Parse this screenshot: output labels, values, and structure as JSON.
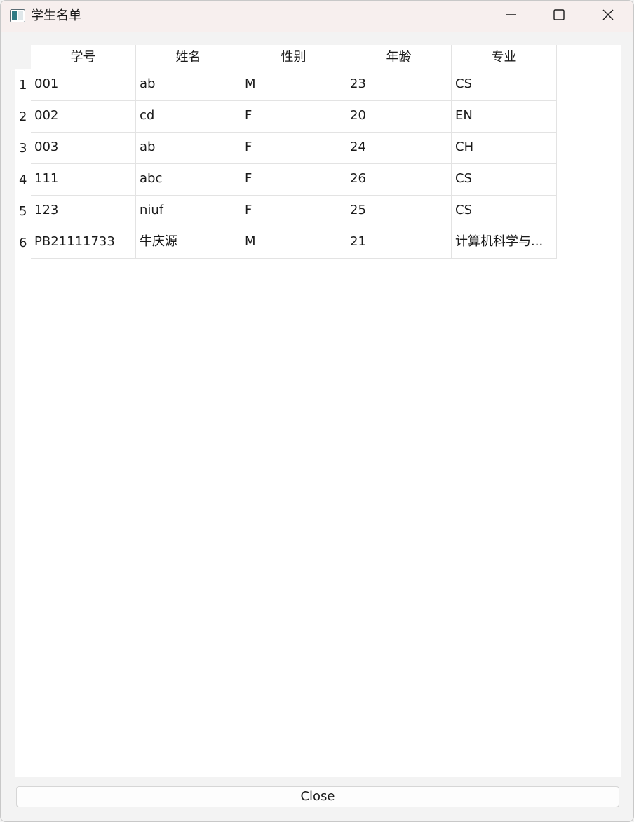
{
  "window": {
    "title": "学生名单",
    "icon": "app-window-icon",
    "controls": [
      "minimize-icon",
      "maximize-icon",
      "close-icon"
    ]
  },
  "table": {
    "columns": [
      "学号",
      "姓名",
      "性别",
      "年龄",
      "专业"
    ],
    "row_numbers": [
      "1",
      "2",
      "3",
      "4",
      "5",
      "6"
    ],
    "rows": [
      [
        "001",
        "ab",
        "M",
        "23",
        "CS"
      ],
      [
        "002",
        "cd",
        "F",
        "20",
        "EN"
      ],
      [
        "003",
        "ab",
        "F",
        "24",
        "CH"
      ],
      [
        "111",
        "abc",
        "F",
        "26",
        "CS"
      ],
      [
        "123",
        "niuf",
        "F",
        "25",
        "CS"
      ],
      [
        "PB21111733",
        "牛庆源",
        "M",
        "21",
        "计算机科学与..."
      ]
    ]
  },
  "footer": {
    "close_label": "Close"
  },
  "colors": {
    "titlebar": "#f7efee",
    "background": "#f3f3f3",
    "grid": "#e3e3e3"
  }
}
